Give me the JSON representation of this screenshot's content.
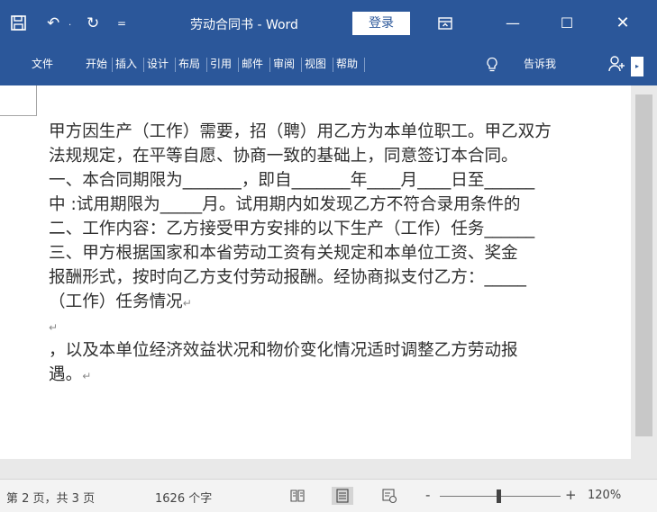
{
  "titlebar": {
    "doc_title": "劳动合同书 - Word",
    "login_label": "登录",
    "icons": [
      "save-icon",
      "undo-icon",
      "redo-icon",
      "customize-qat-icon",
      "ribbon-display-options-icon",
      "minimize-icon",
      "maximize-icon",
      "close-icon"
    ],
    "undo_arrow": "·",
    "customize_glyph": "=",
    "min_glyph": "—",
    "max_glyph": "☐",
    "close_glyph": "✕"
  },
  "ribbon": {
    "tabs": [
      {
        "label": "文件"
      },
      {
        "label": "开始"
      },
      {
        "label": "插入"
      },
      {
        "label": "设计"
      },
      {
        "label": "布局"
      },
      {
        "label": "引用"
      },
      {
        "label": "邮件"
      },
      {
        "label": "审阅"
      },
      {
        "label": "视图"
      },
      {
        "label": "帮助"
      }
    ],
    "tell_me": "告诉我",
    "scroll_glyph": "▸"
  },
  "document": {
    "lines": [
      "甲方因生产（工作）需要，招（聘）用乙方为本单位职工。甲乙双方",
      "法规规定，在平等自愿、协商一致的基础上，同意签订本合同。",
      "一、本合同期限为_______，即自_______年____月____日至______",
      "中 :试用期限为_____月。试用期内如发现乙方不符合录用条件的",
      "二、工作内容：乙方接受甲方安排的以下生产（工作）任务______",
      "三、甲方根据国家和本省劳动工资有关规定和本单位工资、奖金",
      "报酬形式，按时向乙方支付劳动报酬。经协商拟支付乙方：_____",
      "（工作）任务情况"
    ],
    "line8_mark": "↵",
    "empty_mark": "↵",
    "line9": "，以及本单位经济效益状况和物价变化情况适时调整乙方劳动报",
    "line10": "遇。",
    "line10_mark": "↵"
  },
  "statusbar": {
    "page_info": "第 2 页，共 3 页",
    "word_count": "1626 个字",
    "zoom_minus": "-",
    "zoom_plus": "+",
    "zoom_level": "120%",
    "zoom_percent": 120
  },
  "colors": {
    "title_bar": "#2b579a",
    "status_bar": "#f3f3f3",
    "text": "#2f2f2f"
  }
}
